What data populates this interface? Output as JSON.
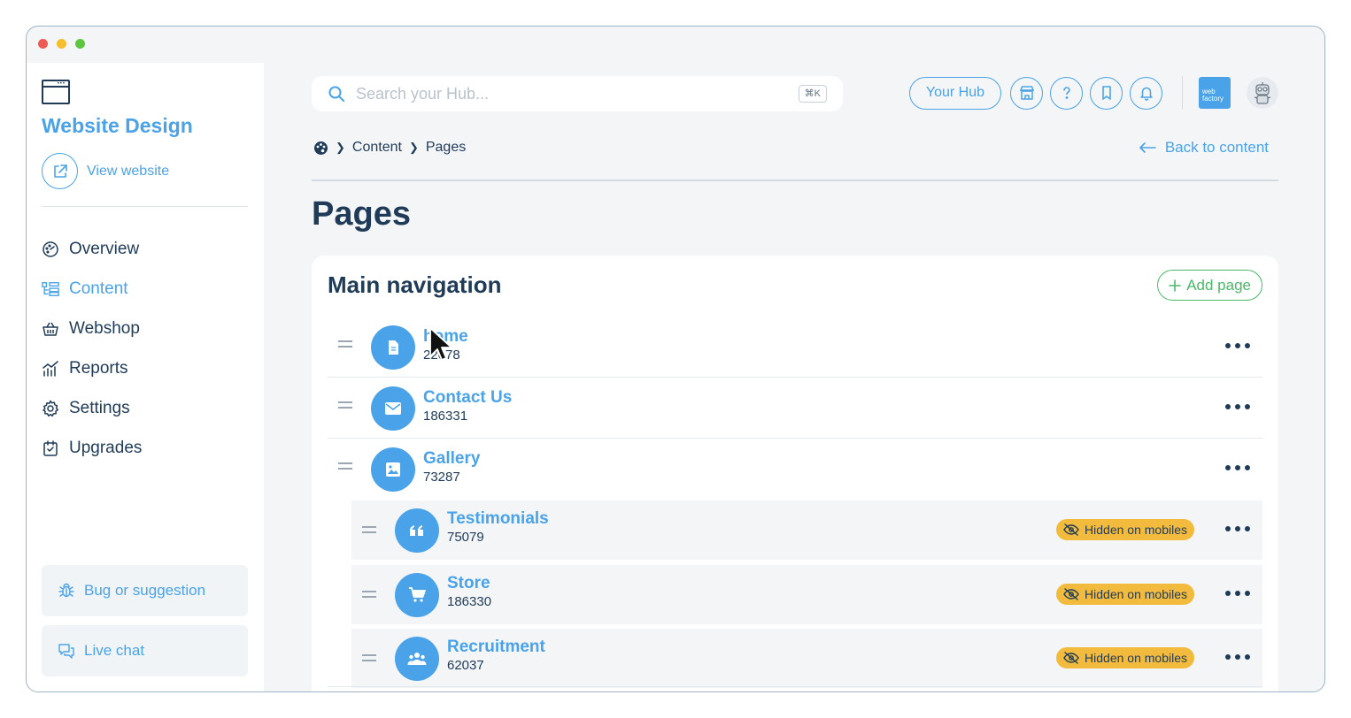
{
  "sidebar": {
    "site_title": "Website Design",
    "view_website": "View website",
    "nav": [
      {
        "label": "Overview",
        "icon": "gauge-icon"
      },
      {
        "label": "Content",
        "icon": "content-tree-icon",
        "active": true
      },
      {
        "label": "Webshop",
        "icon": "basket-icon"
      },
      {
        "label": "Reports",
        "icon": "chart-icon"
      },
      {
        "label": "Settings",
        "icon": "gear-icon"
      },
      {
        "label": "Upgrades",
        "icon": "calendar-check-icon"
      }
    ],
    "bug_label": "Bug or suggestion",
    "chat_label": "Live chat"
  },
  "header": {
    "search_placeholder": "Search your Hub...",
    "search_shortcut": "⌘K",
    "hub_button": "Your Hub",
    "brand_logo_text": "web factory"
  },
  "breadcrumb": {
    "items": [
      "Content",
      "Pages"
    ]
  },
  "back_link": "Back to content",
  "page_title": "Pages",
  "card": {
    "title": "Main navigation",
    "add_button": "Add page",
    "hidden_label": "Hidden on mobiles",
    "pages": [
      {
        "name": "home",
        "id": "22078",
        "icon": "document-icon",
        "sub": false,
        "hidden": false
      },
      {
        "name": "Contact Us",
        "id": "186331",
        "icon": "envelope-icon",
        "sub": false,
        "hidden": false
      },
      {
        "name": "Gallery",
        "id": "73287",
        "icon": "image-icon",
        "sub": false,
        "hidden": false
      },
      {
        "name": "Testimonials",
        "id": "75079",
        "icon": "quote-icon",
        "sub": true,
        "hidden": true
      },
      {
        "name": "Store",
        "id": "186330",
        "icon": "cart-icon",
        "sub": true,
        "hidden": true
      },
      {
        "name": "Recruitment",
        "id": "62037",
        "icon": "people-icon",
        "sub": true,
        "hidden": true
      }
    ]
  },
  "colors": {
    "accent": "#4aa3e8",
    "text": "#1f3b57",
    "success": "#4cb86a",
    "warning": "#f3bb3e"
  }
}
